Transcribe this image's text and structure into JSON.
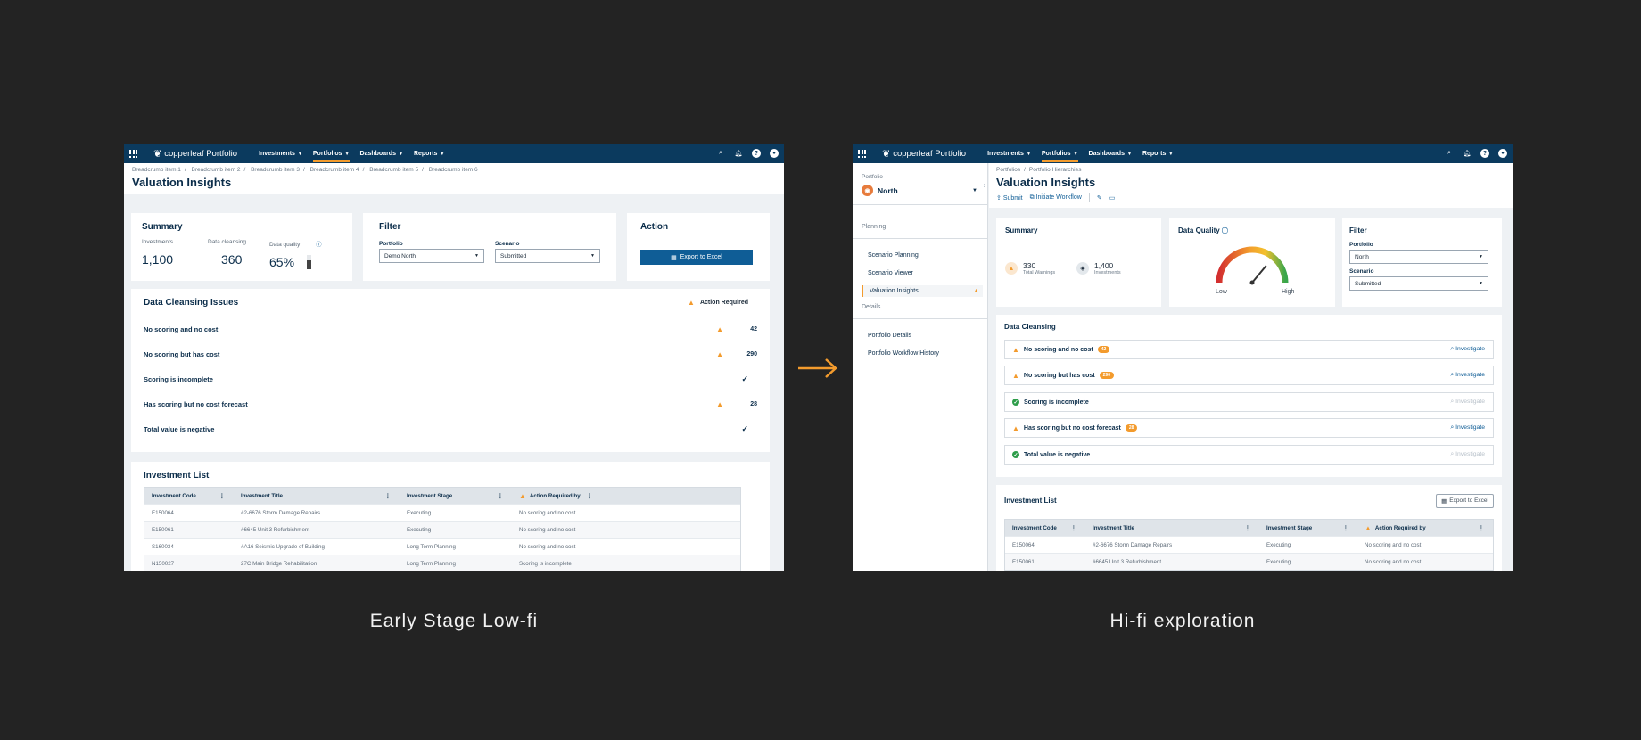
{
  "app": {
    "name": "copperleaf Portfolio",
    "nav": [
      "Investments",
      "Portfolios",
      "Dashboards",
      "Reports"
    ],
    "active_nav": "Portfolios"
  },
  "colors": {
    "topbar": "#0b3a5e",
    "accent": "#f39b2d",
    "primary": "#0f5d96",
    "ok": "#2e9d4a",
    "page_bg": "#232323"
  },
  "lofi": {
    "caption": "Early Stage Low-fi",
    "breadcrumbs": [
      "Breadcrumb item 1",
      "Breadcrumb item 2",
      "Breadcrumb item 3",
      "Breadcrumb item 4",
      "Breadcrumb item 5",
      "Breadcrumb item 6"
    ],
    "title": "Valuation Insights",
    "summary": {
      "title": "Summary",
      "investments_label": "Investments",
      "investments": "1,100",
      "cleansing_label": "Data cleansing",
      "cleansing": "360",
      "quality_label": "Data quality",
      "quality": "65%",
      "quality_level": 0.65
    },
    "filter": {
      "title": "Filter",
      "portfolio_label": "Portfolio",
      "portfolio": "Demo North",
      "scenario_label": "Scenario",
      "scenario": "Submitted"
    },
    "action": {
      "title": "Action",
      "export": "Export to Excel"
    },
    "issues": {
      "title": "Data Cleansing Issues",
      "status": "Action Required",
      "rows": [
        {
          "label": "No scoring and no cost",
          "count": "42",
          "warn": true
        },
        {
          "label": "No scoring but has cost",
          "count": "290",
          "warn": true
        },
        {
          "label": "Scoring is incomplete",
          "count": "",
          "warn": false
        },
        {
          "label": "Has scoring but no cost forecast",
          "count": "28",
          "warn": true
        },
        {
          "label": "Total value is negative",
          "count": "",
          "warn": false
        }
      ]
    },
    "investments": {
      "title": "Investment List",
      "columns": [
        "Investment Code",
        "Investment Title",
        "Investment Stage",
        "Action Required by"
      ],
      "rows": [
        [
          "E150064",
          "#2-6676 Storm Damage Repairs",
          "Executing",
          "No scoring and no cost"
        ],
        [
          "E150061",
          "#6645 Unit 3 Refurbishment",
          "Executing",
          "No scoring and no cost"
        ],
        [
          "S160034",
          "#A16 Seismic Upgrade of Building",
          "Long Term Planning",
          "No scoring and no cost"
        ],
        [
          "N150027",
          "27C Main Bridge Rehabilitation",
          "Long Term Planning",
          "Scoring is incomplete"
        ]
      ]
    }
  },
  "hifi": {
    "caption": "Hi-fi exploration",
    "sidebar": {
      "portfolio_label": "Portfolio",
      "portfolio": "North",
      "sections": [
        {
          "title": "Planning",
          "items": [
            "Scenario Planning",
            "Scenario Viewer",
            "Valuation Insights"
          ]
        },
        {
          "title": "Details",
          "items": [
            "Portfolio Details",
            "Portfolio Workflow History"
          ]
        }
      ]
    },
    "breadcrumbs": [
      "Portfolios",
      "Portfolio Hierarchies"
    ],
    "title": "Valuation Insights",
    "actions": {
      "submit": "Submit",
      "workflow": "Initiate Workflow"
    },
    "summary": {
      "title": "Summary",
      "warnings": "330",
      "warnings_label": "Total Warnings",
      "investments": "1,400",
      "investments_label": "Investments"
    },
    "quality": {
      "title": "Data Quality",
      "low": "Low",
      "high": "High",
      "level": 0.72
    },
    "filter": {
      "title": "Filter",
      "portfolio_label": "Portfolio",
      "portfolio": "North",
      "scenario_label": "Scenario",
      "scenario": "Submitted"
    },
    "cleansing": {
      "title": "Data Cleansing",
      "link": "Investigate",
      "rows": [
        {
          "label": "No scoring and no cost",
          "badge": "42",
          "warn": true
        },
        {
          "label": "No scoring but has cost",
          "badge": "290",
          "warn": true
        },
        {
          "label": "Scoring is incomplete",
          "badge": "",
          "warn": false
        },
        {
          "label": "Has scoring but no cost forecast",
          "badge": "28",
          "warn": true
        },
        {
          "label": "Total value is negative",
          "badge": "",
          "warn": false
        }
      ]
    },
    "investments": {
      "title": "Investment List",
      "export": "Export to Excel",
      "columns": [
        "Investment Code",
        "Investment Title",
        "Investment Stage",
        "Action Required by"
      ],
      "rows": [
        [
          "E150064",
          "#2-6676 Storm Damage Repairs",
          "Executing",
          "No scoring and no cost"
        ],
        [
          "E150061",
          "#6645 Unit 3 Refurbishment",
          "Executing",
          "No scoring and no cost"
        ]
      ]
    }
  }
}
